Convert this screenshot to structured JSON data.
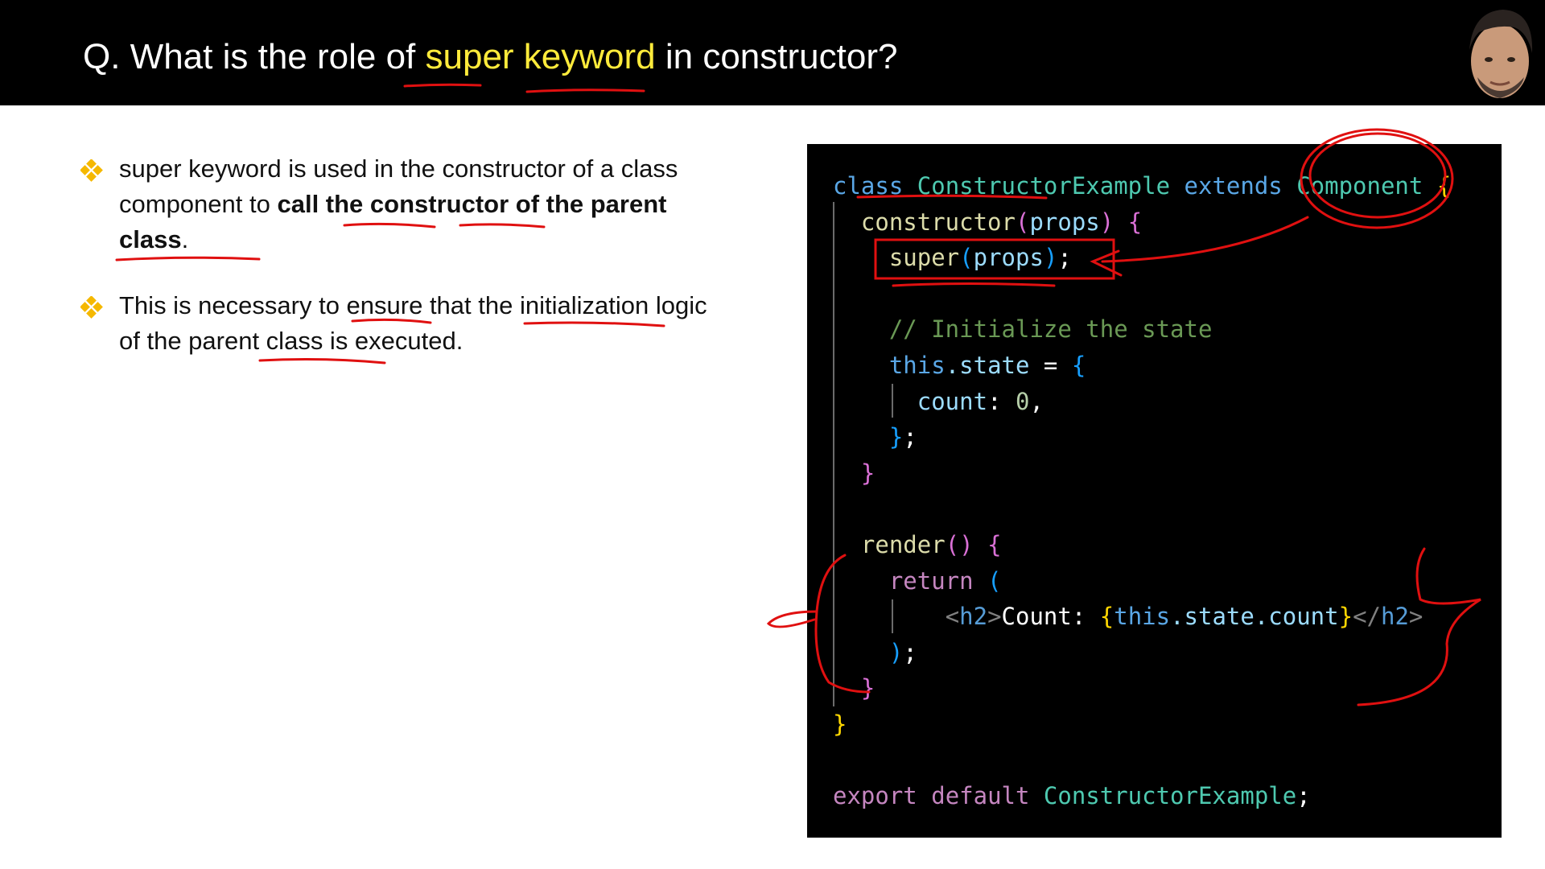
{
  "header": {
    "title_before": "Q. What is the role of ",
    "title_highlight": "super keyword",
    "title_after": " in constructor?",
    "highlight_color": "#ffeb3b"
  },
  "presenter": {
    "icon": "presenter-avatar"
  },
  "bullets": [
    {
      "icon": "diamond-bullet-icon",
      "text_a": "super keyword is used in the constructor of a class component to ",
      "text_bold": "call the constructor of the parent class",
      "text_b": "."
    },
    {
      "icon": "diamond-bullet-icon",
      "text_a": "This is necessary to ensure that the initialization logic of the parent class is executed."
    }
  ],
  "code": {
    "l1": {
      "kw": "class",
      "name": "ConstructorExample",
      "ext": "extends",
      "base": "Component",
      "brace": "{"
    },
    "l2": {
      "fn": "constructor",
      "open": "(",
      "arg": "props",
      "close": ")",
      "brace": "{"
    },
    "l3": {
      "kw": "super",
      "open": "(",
      "arg": "props",
      "close": ")",
      "semi": ";"
    },
    "l5": {
      "comment": "// Initialize the state"
    },
    "l6": {
      "kw": "this",
      "prop": ".state",
      "eq": " = ",
      "brace": "{"
    },
    "l7": {
      "key": "count",
      "colon": ": ",
      "num": "0",
      "comma": ","
    },
    "l8": {
      "brace": "}",
      "semi": ";"
    },
    "l9": {
      "brace": "}"
    },
    "l11": {
      "fn": "render",
      "parens": "()",
      "brace": "{"
    },
    "l12": {
      "kw": "return",
      "paren": "("
    },
    "l13": {
      "open_tag": "<",
      "tag": "h2",
      "gt": ">",
      "text": "Count: ",
      "lb": "{",
      "this": "this",
      "path": ".state.count",
      "rb": "}",
      "close_tag": "</",
      "tag2": "h2",
      "gt2": ">"
    },
    "l14": {
      "paren": ")",
      "semi": ";"
    },
    "l15": {
      "brace": "}"
    },
    "l16": {
      "brace": "}"
    },
    "l18": {
      "export": "export",
      "default": "default",
      "name": "ConstructorExample",
      "semi": ";"
    }
  },
  "colors": {
    "keyword": "#5aa7e6",
    "class_name": "#4ec9b0",
    "function": "#dcdcaa",
    "control": "#c586c0",
    "comment": "#6a9955",
    "number": "#b5cea8",
    "annotation_ink": "#e01010",
    "bullet_icon": "#f5b800"
  }
}
